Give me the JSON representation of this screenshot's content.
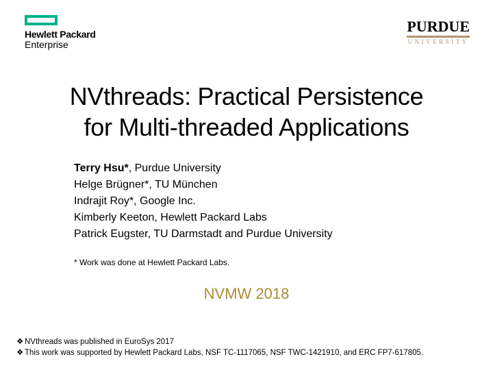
{
  "logos": {
    "hpe_line1": "Hewlett Packard",
    "hpe_line2": "Enterprise",
    "purdue_name": "PURDUE",
    "purdue_sub": "UNIVERSITY"
  },
  "title_line1": "NVthreads: Practical Persistence",
  "title_line2": "for Multi-threaded Applications",
  "authors": {
    "lead_name": "Terry Hsu*",
    "lead_affil": ", Purdue University",
    "a2": "Helge Brügner*, TU München",
    "a3": "Indrajit Roy*, Google Inc.",
    "a4": "Kimberly Keeton, Hewlett Packard Labs",
    "a5": "Patrick Eugster, TU Darmstadt and Purdue University"
  },
  "note": "* Work was done at Hewlett Packard Labs.",
  "venue": "NVMW 2018",
  "footnotes": {
    "f1": "NVthreads was published in EuroSys 2017",
    "f2": "This work was supported by Hewlett Packard Labs, NSF TC-1117065, NSF TWC-1421910, and ERC FP7-617805."
  }
}
